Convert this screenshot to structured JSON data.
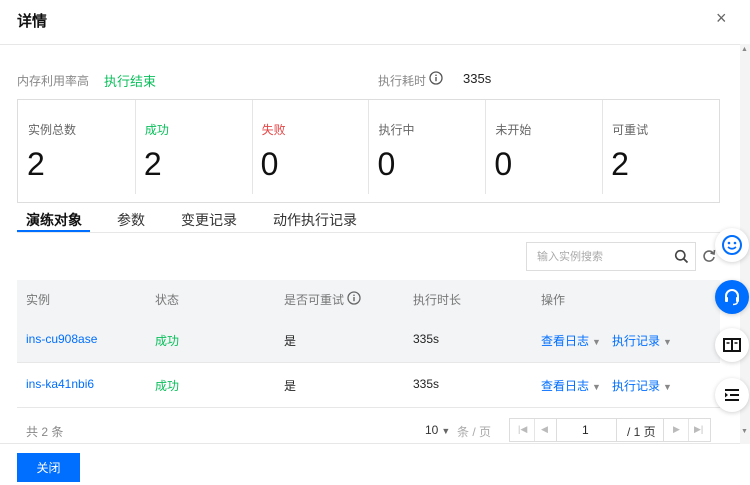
{
  "dialog": {
    "title": "详情",
    "close_symbol": "×"
  },
  "meta": {
    "metric_label": "内存利用率高",
    "status_value": "执行结束",
    "duration_label": "执行耗时",
    "duration_value": "335s"
  },
  "stats": [
    {
      "label": "实例总数",
      "value": "2"
    },
    {
      "label": "成功",
      "value": "2"
    },
    {
      "label": "失败",
      "value": "0"
    },
    {
      "label": "执行中",
      "value": "0"
    },
    {
      "label": "未开始",
      "value": "0"
    },
    {
      "label": "可重试",
      "value": "2"
    }
  ],
  "tabs": [
    "演练对象",
    "参数",
    "变更记录",
    "动作执行记录"
  ],
  "search": {
    "placeholder": "输入实例搜索"
  },
  "table": {
    "headers": [
      "实例",
      "状态",
      "是否可重试",
      "执行时长",
      "操作"
    ],
    "rows": [
      {
        "instance": "ins-cu908ase",
        "status": "成功",
        "retryable": "是",
        "duration": "335s",
        "action_log": "查看日志",
        "action_record": "执行记录"
      },
      {
        "instance": "ins-ka41nbi6",
        "status": "成功",
        "retryable": "是",
        "duration": "335s",
        "action_log": "查看日志",
        "action_record": "执行记录"
      }
    ]
  },
  "pagination": {
    "total_text": "共 2 条",
    "page_size": "10",
    "page_size_unit": "条 / 页",
    "current_page": "1",
    "total_pages_text": "/ 1 页"
  },
  "footer": {
    "close_label": "关闭"
  },
  "colors": {
    "accent": "#006eff",
    "success": "#0abf5b",
    "danger": "#e54545"
  }
}
